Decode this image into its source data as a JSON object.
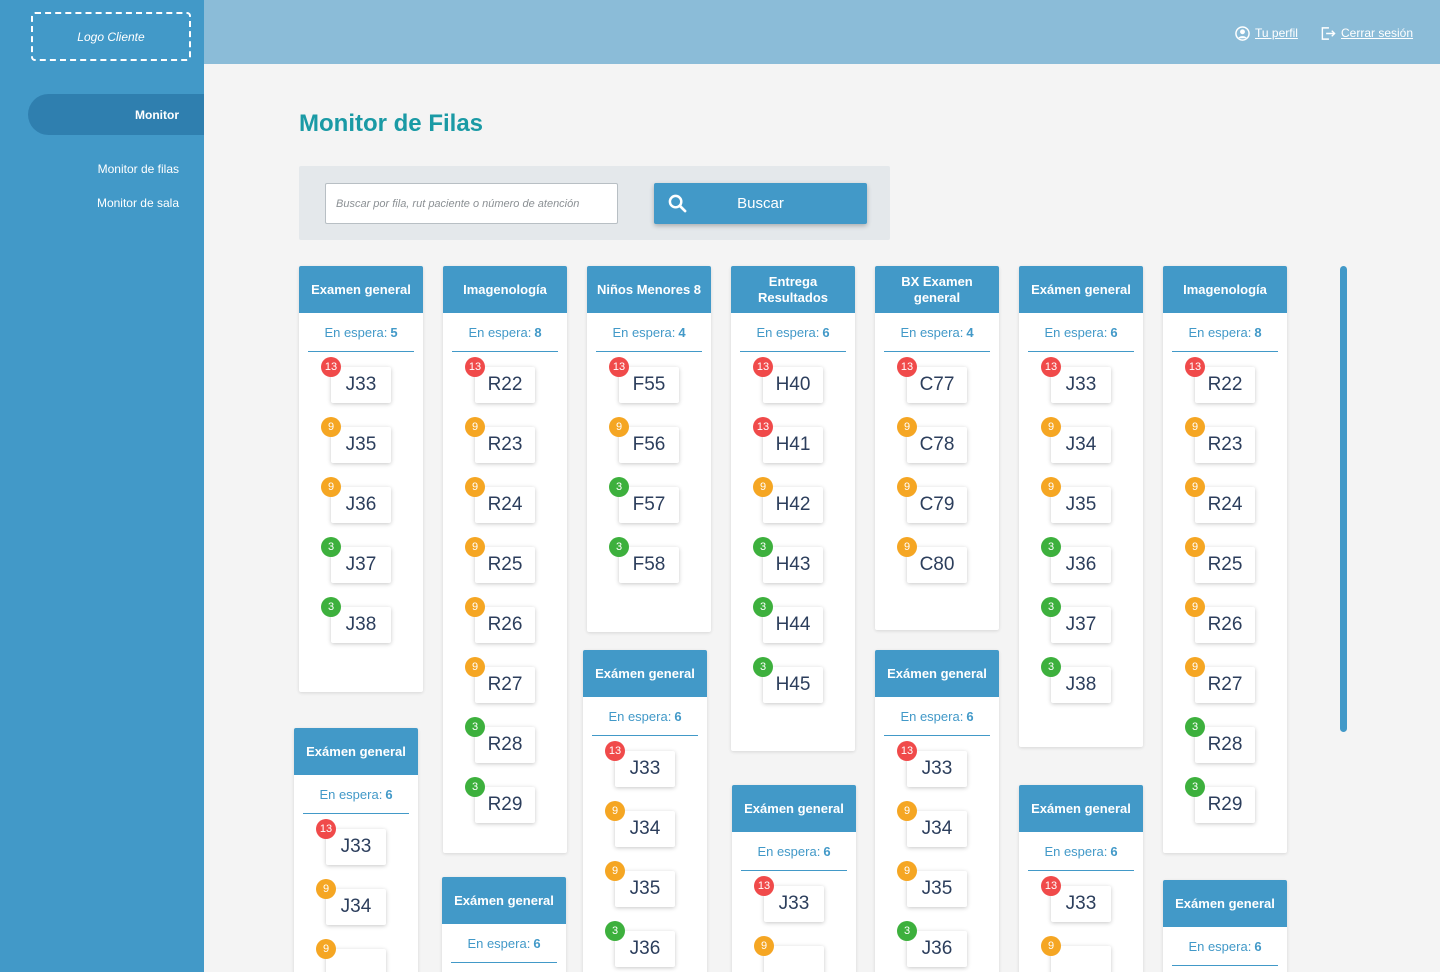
{
  "sidebar": {
    "logo": "Logo Cliente",
    "active_item": "Monitor",
    "sub_items": [
      "Monitor de filas",
      "Monitor de sala"
    ]
  },
  "topbar": {
    "profile": "Tu perfil",
    "logout": "Cerrar sesión"
  },
  "page": {
    "title": "Monitor de Filas"
  },
  "search": {
    "placeholder": "Buscar por fila, rut paciente o número de atención",
    "button": "Buscar"
  },
  "wait_label": "En espera:",
  "colors": {
    "primary": "#4299c8",
    "title": "#1a9aa5",
    "badge_red": "#f04a4a",
    "badge_orange": "#f5a623",
    "badge_green": "#3db03d"
  },
  "queues": [
    {
      "title": "Examen general",
      "waiting": "5",
      "tickets": [
        {
          "code": "J33",
          "badge": "13"
        },
        {
          "code": "J35",
          "badge": "9"
        },
        {
          "code": "J36",
          "badge": "9"
        },
        {
          "code": "J37",
          "badge": "3"
        },
        {
          "code": "J38",
          "badge": "3"
        }
      ]
    },
    {
      "title": "Exámen general",
      "waiting": "6",
      "tickets": [
        {
          "code": "J33",
          "badge": "13"
        },
        {
          "code": "J34",
          "badge": "9"
        },
        {
          "code": "",
          "badge": "9"
        }
      ]
    },
    {
      "title": "Imagenología",
      "waiting": "8",
      "tickets": [
        {
          "code": "R22",
          "badge": "13"
        },
        {
          "code": "R23",
          "badge": "9"
        },
        {
          "code": "R24",
          "badge": "9"
        },
        {
          "code": "R25",
          "badge": "9"
        },
        {
          "code": "R26",
          "badge": "9"
        },
        {
          "code": "R27",
          "badge": "9"
        },
        {
          "code": "R28",
          "badge": "3"
        },
        {
          "code": "R29",
          "badge": "3"
        }
      ]
    },
    {
      "title": "Exámen general",
      "waiting": "6",
      "tickets": []
    },
    {
      "title": "Niños Menores 8",
      "waiting": "4",
      "tickets": [
        {
          "code": "F55",
          "badge": "13"
        },
        {
          "code": "F56",
          "badge": "9"
        },
        {
          "code": "F57",
          "badge": "3"
        },
        {
          "code": "F58",
          "badge": "3"
        }
      ]
    },
    {
      "title": "Exámen general",
      "waiting": "6",
      "tickets": [
        {
          "code": "J33",
          "badge": "13"
        },
        {
          "code": "J34",
          "badge": "9"
        },
        {
          "code": "J35",
          "badge": "9"
        },
        {
          "code": "J36",
          "badge": "3"
        }
      ]
    },
    {
      "title": "Entrega Resultados",
      "waiting": "6",
      "tickets": [
        {
          "code": "H40",
          "badge": "13"
        },
        {
          "code": "H41",
          "badge": "13"
        },
        {
          "code": "H42",
          "badge": "9"
        },
        {
          "code": "H43",
          "badge": "3"
        },
        {
          "code": "H44",
          "badge": "3"
        },
        {
          "code": "H45",
          "badge": "3"
        }
      ]
    },
    {
      "title": "Exámen general",
      "waiting": "6",
      "tickets": [
        {
          "code": "J33",
          "badge": "13"
        },
        {
          "code": "",
          "badge": "9"
        }
      ]
    },
    {
      "title": "BX Examen general",
      "waiting": "4",
      "tickets": [
        {
          "code": "C77",
          "badge": "13"
        },
        {
          "code": "C78",
          "badge": "9"
        },
        {
          "code": "C79",
          "badge": "9"
        },
        {
          "code": "C80",
          "badge": "9"
        }
      ]
    },
    {
      "title": "Exámen general",
      "waiting": "6",
      "tickets": [
        {
          "code": "J33",
          "badge": "13"
        },
        {
          "code": "J34",
          "badge": "9"
        },
        {
          "code": "J35",
          "badge": "9"
        },
        {
          "code": "J36",
          "badge": "3"
        }
      ]
    },
    {
      "title": "Exámen general",
      "waiting": "6",
      "tickets": [
        {
          "code": "J33",
          "badge": "13"
        },
        {
          "code": "J34",
          "badge": "9"
        },
        {
          "code": "J35",
          "badge": "9"
        },
        {
          "code": "J36",
          "badge": "3"
        },
        {
          "code": "J37",
          "badge": "3"
        },
        {
          "code": "J38",
          "badge": "3"
        }
      ]
    },
    {
      "title": "Exámen general",
      "waiting": "6",
      "tickets": [
        {
          "code": "J33",
          "badge": "13"
        },
        {
          "code": "",
          "badge": "9"
        }
      ]
    },
    {
      "title": "Imagenología",
      "waiting": "8",
      "tickets": [
        {
          "code": "R22",
          "badge": "13"
        },
        {
          "code": "R23",
          "badge": "9"
        },
        {
          "code": "R24",
          "badge": "9"
        },
        {
          "code": "R25",
          "badge": "9"
        },
        {
          "code": "R26",
          "badge": "9"
        },
        {
          "code": "R27",
          "badge": "9"
        },
        {
          "code": "R28",
          "badge": "3"
        },
        {
          "code": "R29",
          "badge": "3"
        }
      ]
    },
    {
      "title": "Exámen general",
      "waiting": "6",
      "tickets": []
    }
  ]
}
